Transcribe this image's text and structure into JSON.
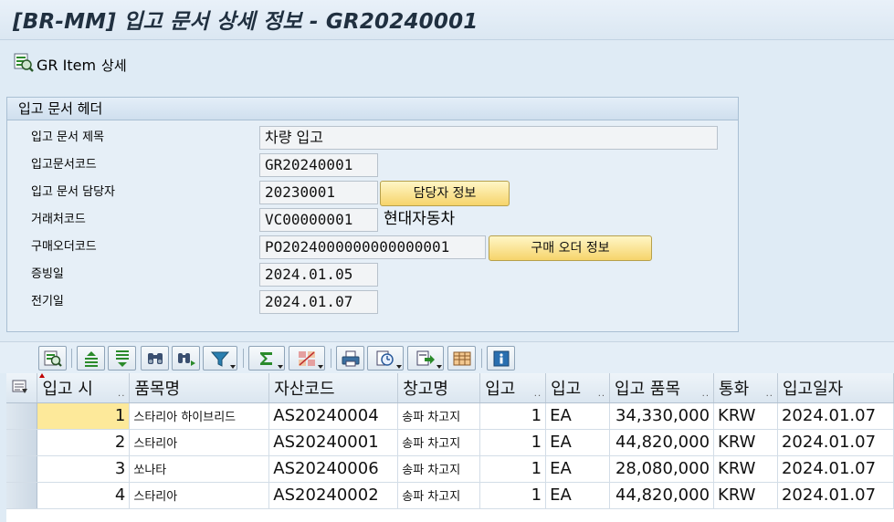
{
  "window": {
    "title": "[BR-MM] 입고 문서 상세 정보 - GR20240001"
  },
  "toolbar": {
    "gr_item_label": "GR Item",
    "gr_item_suffix": "상세"
  },
  "header": {
    "group_title": "입고 문서 헤더",
    "fields": {
      "doc_title": {
        "label": "입고 문서 제목",
        "value": "차량 입고"
      },
      "doc_code": {
        "label": "입고문서코드",
        "value": "GR20240001"
      },
      "manager": {
        "label": "입고 문서 담당자",
        "value": "20230001",
        "button": "담당자 정보"
      },
      "vendor": {
        "label": "거래처코드",
        "value": "VC00000001",
        "desc": "현대자동차"
      },
      "po": {
        "label": "구매오더코드",
        "value": "PO2024000000000000001",
        "button": "구매 오더 정보"
      },
      "doc_date": {
        "label": "증빙일",
        "value": "2024.01.05"
      },
      "post_date": {
        "label": "전기일",
        "value": "2024.01.07"
      }
    }
  },
  "grid": {
    "columns": [
      "입고 시",
      "품목명",
      "자산코드",
      "창고명",
      "입고",
      "입고",
      "입고 품목",
      "통화",
      "입고일자"
    ],
    "rows": [
      [
        "1",
        "스타리아 하이브리드",
        "AS20240004",
        "송파 차고지",
        "1",
        "EA",
        "34,330,000",
        "KRW",
        "2024.01.07"
      ],
      [
        "2",
        "스타리아",
        "AS20240001",
        "송파 차고지",
        "1",
        "EA",
        "44,820,000",
        "KRW",
        "2024.01.07"
      ],
      [
        "3",
        "쏘나타",
        "AS20240006",
        "송파 차고지",
        "1",
        "EA",
        "28,080,000",
        "KRW",
        "2024.01.07"
      ],
      [
        "4",
        "스타리아",
        "AS20240002",
        "송파 차고지",
        "1",
        "EA",
        "44,820,000",
        "KRW",
        "2024.01.07"
      ]
    ]
  },
  "colors": {
    "background": "#dfebf5",
    "button_yellow": "#f6d46b",
    "highlight_cell": "#fde99a"
  },
  "icons": [
    "detail-search-icon",
    "details-icon",
    "sort-ascending-icon",
    "sort-descending-icon",
    "find-icon",
    "find-next-icon",
    "filter-icon",
    "sum-icon",
    "subtotal-icon",
    "print-icon",
    "view-icon",
    "export-icon",
    "layout-icon",
    "info-icon",
    "column-settings-icon"
  ]
}
